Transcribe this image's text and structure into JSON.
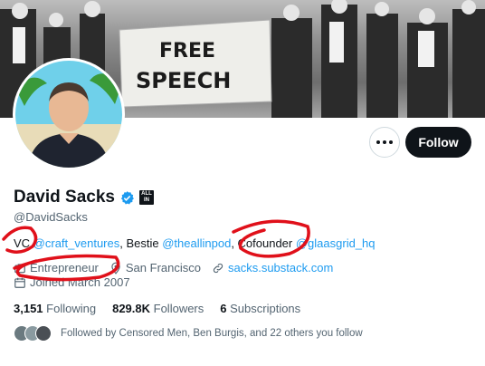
{
  "banner": {
    "sign_line1": "FREE",
    "sign_line2": "SPEECH"
  },
  "profile": {
    "name": "David Sacks",
    "handle": "@DavidSacks",
    "affiliation_badge": "ALL IN",
    "bio": {
      "p1": "VC ",
      "link1": "@craft_ventures",
      "p2": ", Bestie ",
      "link2": "@theallinpod",
      "p3": ", Cofounder ",
      "link3": "@glaasgrid_hq"
    },
    "category": "Entrepreneur",
    "location": "San Francisco",
    "website": "sacks.substack.com",
    "joined": "Joined March 2007"
  },
  "actions": {
    "follow_label": "Follow"
  },
  "stats": {
    "following_count": "3,151",
    "following_label": "Following",
    "followers_count": "829.8K",
    "followers_label": "Followers",
    "subscriptions_count": "6",
    "subscriptions_label": "Subscriptions"
  },
  "followed_by": "Followed by Censored Men, Ben Burgis, and 22 others you follow",
  "colors": {
    "accent": "#1d9bf0",
    "text": "#0f1419",
    "muted": "#536471",
    "annotation": "#e0101a"
  }
}
